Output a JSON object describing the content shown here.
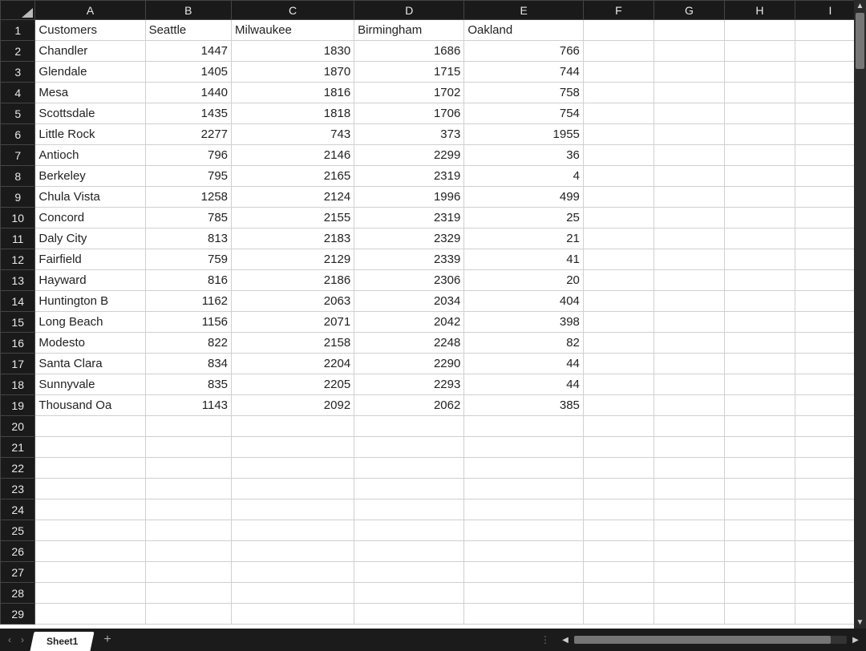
{
  "sheet": {
    "columns": [
      "A",
      "B",
      "C",
      "D",
      "E",
      "F",
      "G",
      "H",
      "I"
    ],
    "visible_row_count": 29,
    "header_row": [
      "Customers",
      "Seattle",
      "Milwaukee",
      "Birmingham",
      "Oakland"
    ],
    "data_rows": [
      [
        "Chandler",
        1447,
        1830,
        1686,
        766
      ],
      [
        "Glendale",
        1405,
        1870,
        1715,
        744
      ],
      [
        "Mesa",
        1440,
        1816,
        1702,
        758
      ],
      [
        "Scottsdale",
        1435,
        1818,
        1706,
        754
      ],
      [
        "Little Rock",
        2277,
        743,
        373,
        1955
      ],
      [
        "Antioch",
        796,
        2146,
        2299,
        36
      ],
      [
        "Berkeley",
        795,
        2165,
        2319,
        4
      ],
      [
        "Chula Vista",
        1258,
        2124,
        1996,
        499
      ],
      [
        "Concord",
        785,
        2155,
        2319,
        25
      ],
      [
        "Daly City",
        813,
        2183,
        2329,
        21
      ],
      [
        "Fairfield",
        759,
        2129,
        2339,
        41
      ],
      [
        "Hayward",
        816,
        2186,
        2306,
        20
      ],
      [
        "Huntington B",
        1162,
        2063,
        2034,
        404
      ],
      [
        "Long Beach",
        1156,
        2071,
        2042,
        398
      ],
      [
        "Modesto",
        822,
        2158,
        2248,
        82
      ],
      [
        "Santa Clara",
        834,
        2204,
        2290,
        44
      ],
      [
        "Sunnyvale",
        835,
        2205,
        2293,
        44
      ],
      [
        "Thousand Oa",
        1143,
        2092,
        2062,
        385
      ]
    ]
  },
  "tabs": {
    "active": "Sheet1",
    "add_label": "+"
  },
  "nav": {
    "prev": "‹",
    "next": "›"
  },
  "scroll": {
    "up": "▲",
    "down": "▼",
    "left": "◀",
    "right": "▶",
    "grip": "⋮"
  }
}
